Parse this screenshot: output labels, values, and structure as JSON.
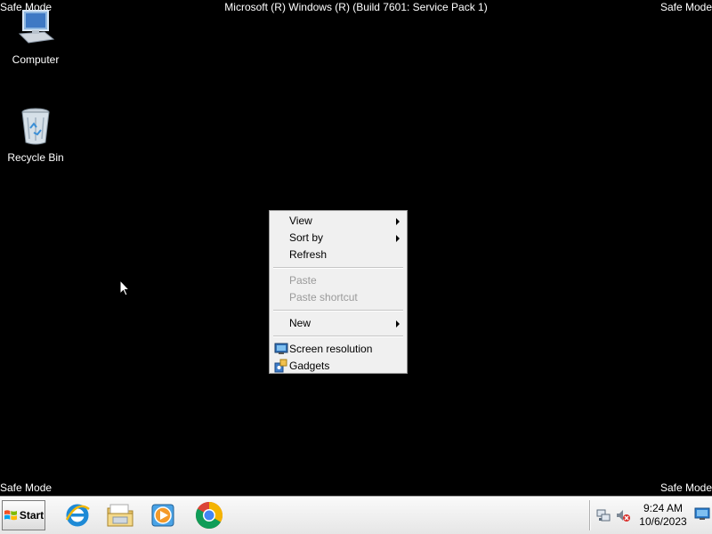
{
  "banner": {
    "safe_mode_label": "Safe Mode",
    "title": "Microsoft (R) Windows (R) (Build 7601: Service Pack 1)"
  },
  "desktop_icons": [
    {
      "label": "Computer",
      "icon": "computer-icon"
    },
    {
      "label": "Recycle Bin",
      "icon": "recycle-bin-icon"
    }
  ],
  "context_menu": {
    "items": [
      {
        "label": "View",
        "submenu": true,
        "enabled": true
      },
      {
        "label": "Sort by",
        "submenu": true,
        "enabled": true
      },
      {
        "label": "Refresh",
        "submenu": false,
        "enabled": true
      },
      {
        "label": "Paste",
        "submenu": false,
        "enabled": false
      },
      {
        "label": "Paste shortcut",
        "submenu": false,
        "enabled": false
      },
      {
        "label": "New",
        "submenu": true,
        "enabled": true
      },
      {
        "label": "Screen resolution",
        "submenu": false,
        "enabled": true,
        "icon": "screen-resolution-icon"
      },
      {
        "label": "Gadgets",
        "submenu": false,
        "enabled": true,
        "icon": "gadgets-icon"
      }
    ]
  },
  "taskbar": {
    "start_label": "Start",
    "pinned": [
      {
        "icon": "internet-explorer-icon"
      },
      {
        "icon": "file-explorer-icon"
      },
      {
        "icon": "media-player-icon"
      },
      {
        "icon": "chrome-icon"
      }
    ],
    "clock": {
      "time": "9:24 AM",
      "date": "10/6/2023"
    }
  },
  "colors": {
    "desktop": "#000000",
    "menu_bg": "#f0f0f0",
    "disabled_text": "#9a9a9a"
  }
}
